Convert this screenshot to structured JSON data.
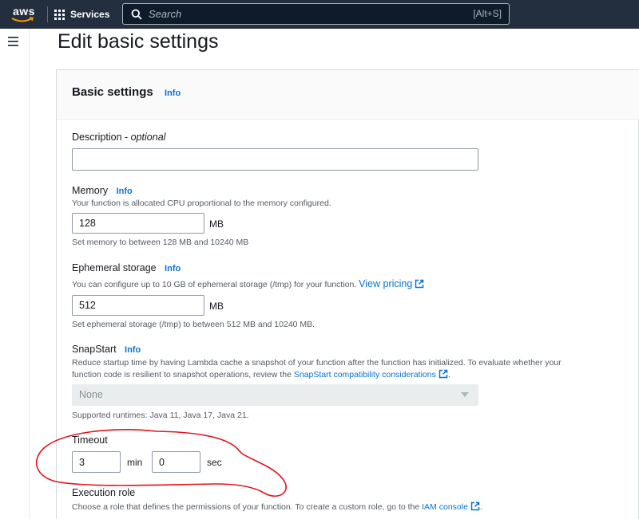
{
  "nav": {
    "logo_text": "aws",
    "services_label": "Services",
    "search_placeholder": "Search",
    "search_shortcut": "[Alt+S]"
  },
  "page": {
    "title": "Edit basic settings"
  },
  "panel": {
    "title": "Basic settings",
    "info": "Info"
  },
  "description": {
    "label": "Description - ",
    "optional": "optional",
    "value": ""
  },
  "memory": {
    "label": "Memory",
    "info": "Info",
    "hint": "Your function is allocated CPU proportional to the memory configured.",
    "value": "128",
    "unit": "MB",
    "constraint": "Set memory to between 128 MB and 10240 MB"
  },
  "ephemeral": {
    "label": "Ephemeral storage",
    "info": "Info",
    "hint": "You can configure up to 10 GB of ephemeral storage (/tmp) for your function.",
    "link": "View pricing",
    "value": "512",
    "unit": "MB",
    "constraint": "Set ephemeral storage (/tmp) to between 512 MB and 10240 MB."
  },
  "snapstart": {
    "label": "SnapStart",
    "info": "Info",
    "hint_line1": "Reduce startup time by having Lambda cache a snapshot of your function after the function has initialized. To evaluate whether your",
    "hint_line2": "function code is resilient to snapshot operations, review the ",
    "link": "SnapStart compatibility considerations",
    "hint_end": ".",
    "selected": "None",
    "supported": "Supported runtimes: Java 11, Java 17, Java 21."
  },
  "timeout": {
    "label": "Timeout",
    "min_value": "3",
    "min_unit": "min",
    "sec_value": "0",
    "sec_unit": "sec"
  },
  "execution_role": {
    "label": "Execution role",
    "hint": "Choose a role that defines the permissions of your function. To create a custom role, go to the ",
    "link": "IAM console",
    "hint_end": "."
  },
  "colors": {
    "nav_bg": "#232f3e",
    "link": "#0972d3",
    "annotation": "#e0141c"
  }
}
